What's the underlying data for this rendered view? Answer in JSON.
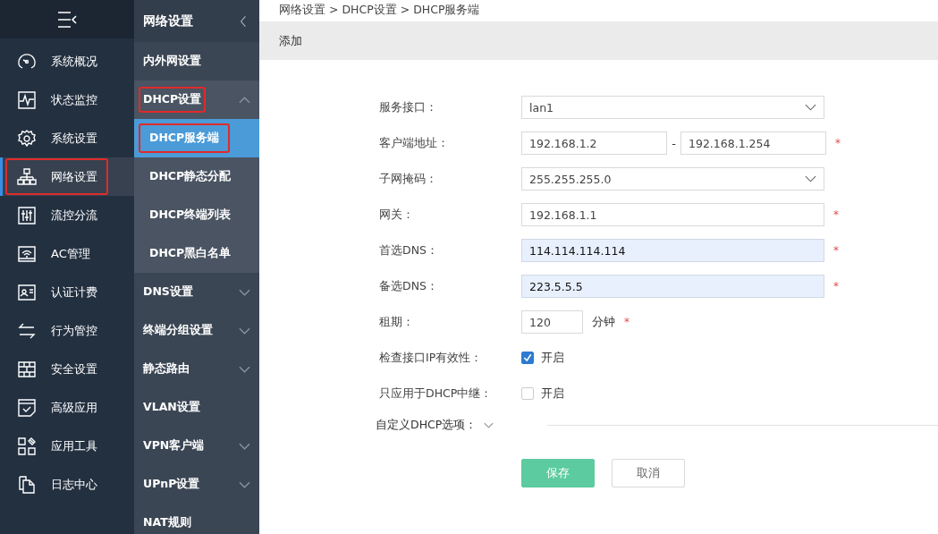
{
  "sidebar": {
    "items": [
      {
        "label": "系统概况",
        "selected": false,
        "annotated": false
      },
      {
        "label": "状态监控",
        "selected": false,
        "annotated": false
      },
      {
        "label": "系统设置",
        "selected": false,
        "annotated": false
      },
      {
        "label": "网络设置",
        "selected": true,
        "annotated": true
      },
      {
        "label": "流控分流",
        "selected": false,
        "annotated": false
      },
      {
        "label": "AC管理",
        "selected": false,
        "annotated": false
      },
      {
        "label": "认证计费",
        "selected": false,
        "annotated": false
      },
      {
        "label": "行为管控",
        "selected": false,
        "annotated": false
      },
      {
        "label": "安全设置",
        "selected": false,
        "annotated": false
      },
      {
        "label": "高级应用",
        "selected": false,
        "annotated": false
      },
      {
        "label": "应用工具",
        "selected": false,
        "annotated": false
      },
      {
        "label": "日志中心",
        "selected": false,
        "annotated": false
      }
    ]
  },
  "subnav": {
    "title": "网络设置",
    "items": [
      {
        "label": "内外网设置",
        "kind": "link",
        "annotated": false
      },
      {
        "label": "DHCP设置",
        "kind": "group",
        "expanded": true,
        "annotated": true,
        "children": [
          {
            "label": "DHCP服务端",
            "selected": true,
            "annotated": true
          },
          {
            "label": "DHCP静态分配",
            "selected": false,
            "annotated": false
          },
          {
            "label": "DHCP终端列表",
            "selected": false,
            "annotated": false
          },
          {
            "label": "DHCP黑白名单",
            "selected": false,
            "annotated": false
          }
        ]
      },
      {
        "label": "DNS设置",
        "kind": "group",
        "expanded": false,
        "annotated": false
      },
      {
        "label": "终端分组设置",
        "kind": "group",
        "expanded": false,
        "annotated": false
      },
      {
        "label": "静态路由",
        "kind": "group",
        "expanded": false,
        "annotated": false
      },
      {
        "label": "VLAN设置",
        "kind": "link",
        "annotated": false
      },
      {
        "label": "VPN客户端",
        "kind": "group",
        "expanded": false,
        "annotated": false
      },
      {
        "label": "UPnP设置",
        "kind": "group",
        "expanded": false,
        "annotated": false
      },
      {
        "label": "NAT规则",
        "kind": "link",
        "annotated": false
      }
    ]
  },
  "breadcrumb": "网络设置 > DHCP设置 > DHCP服务端",
  "panel": {
    "title": "添加"
  },
  "form": {
    "rows": [
      {
        "kind": "select",
        "label": "服务接口：",
        "value": "lan1"
      },
      {
        "kind": "range",
        "label": "客户端地址：",
        "value": "192.168.1.2",
        "separator": "-",
        "value_end": "192.168.1.254",
        "required_mark": "*"
      },
      {
        "kind": "select",
        "label": "子网掩码：",
        "value": "255.255.255.0"
      },
      {
        "kind": "text",
        "label": "网关：",
        "value": "192.168.1.1",
        "required_mark": "*",
        "autofilled": false
      },
      {
        "kind": "text",
        "label": "首选DNS：",
        "value": "114.114.114.114",
        "required_mark": "*",
        "autofilled": true
      },
      {
        "kind": "text",
        "label": "备选DNS：",
        "value": "223.5.5.5",
        "required_mark": "*",
        "autofilled": true
      },
      {
        "kind": "short",
        "label": "租期：",
        "value": "120",
        "unit": "分钟",
        "required_mark": "*"
      },
      {
        "kind": "checkbox",
        "label": "检查接口IP有效性：",
        "checked": true,
        "option": "开启"
      },
      {
        "kind": "checkbox",
        "label": "只应用于DHCP中继：",
        "checked": false,
        "option": "开启"
      }
    ],
    "section": {
      "label": "自定义DHCP选项：",
      "expanded": false
    },
    "buttons": [
      {
        "label": "保存",
        "kind": "primary"
      },
      {
        "label": "取消",
        "kind": "default"
      }
    ]
  }
}
